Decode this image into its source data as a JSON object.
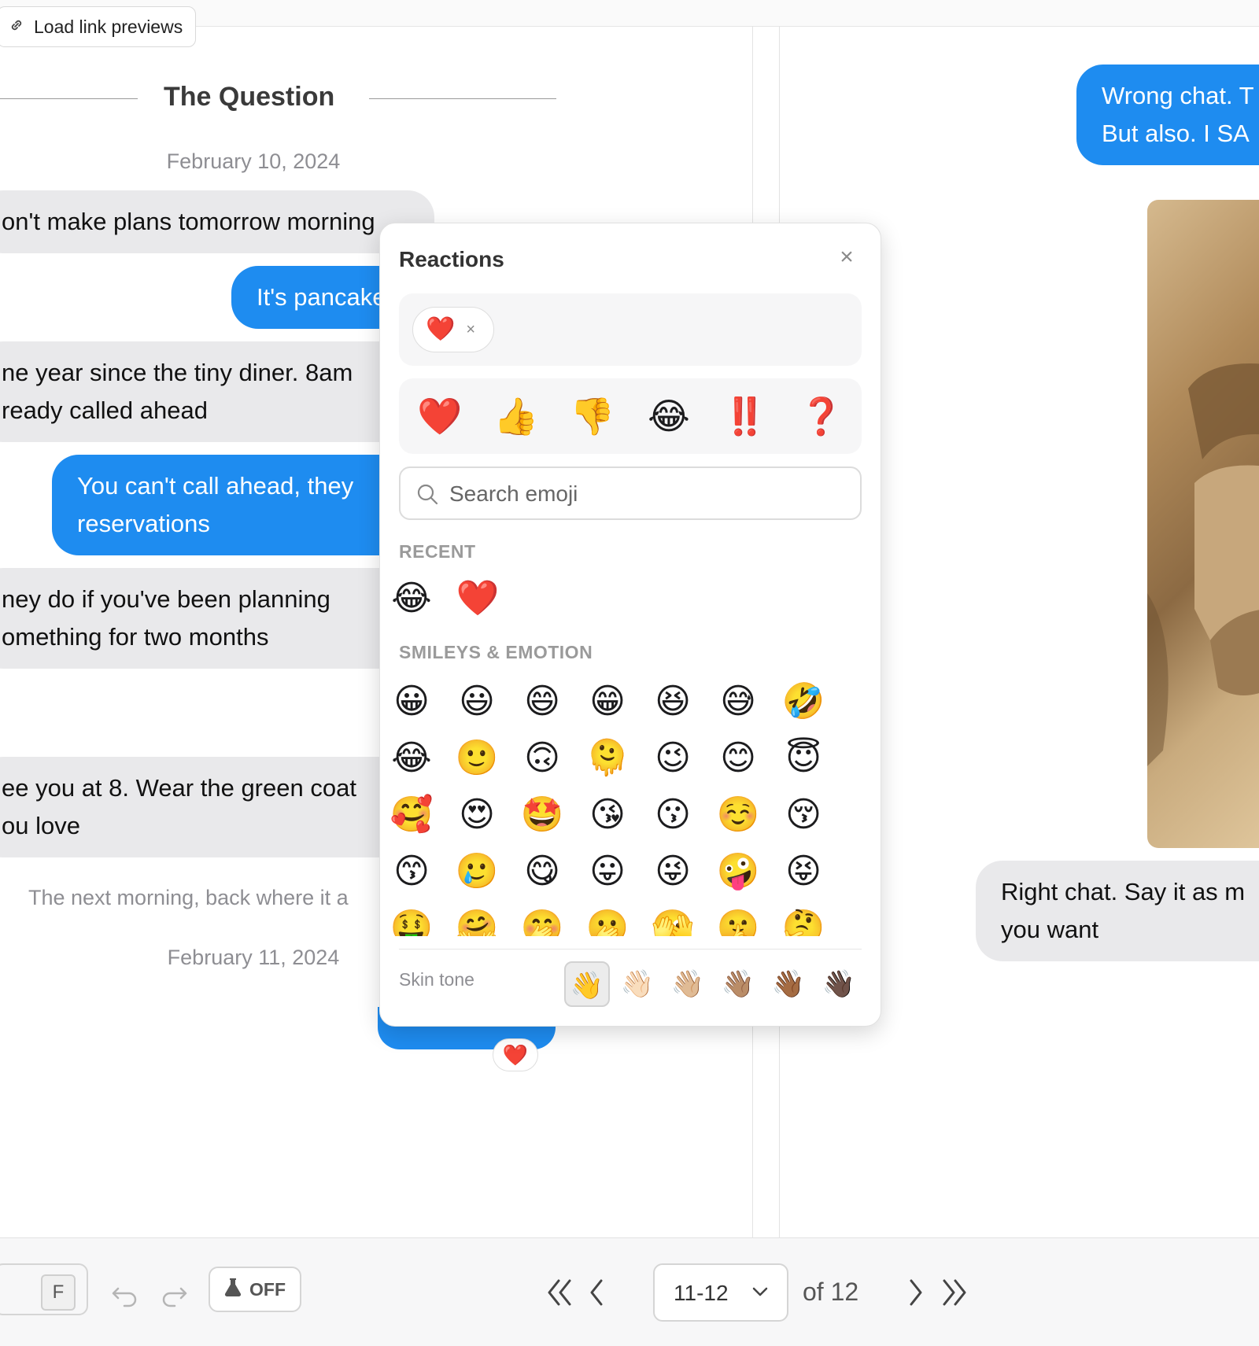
{
  "toolbar_top": {
    "link_previews_label": "Load link previews"
  },
  "chat_left": {
    "title": "The Question",
    "date1": "February 10, 2024",
    "messages": [
      {
        "type": "gray",
        "text": "on't make plans tomorrow morning"
      },
      {
        "type": "blue",
        "text": "It's pancake"
      },
      {
        "type": "gray",
        "line1": "ne year since the tiny diner. 8am",
        "line2": "ready called ahead"
      },
      {
        "type": "blue",
        "line1": "You can't call ahead, they",
        "line2": "reservations"
      },
      {
        "type": "gray",
        "line1": "ney do if you've been planning",
        "line2": "omething for two months"
      },
      {
        "type": "gray",
        "line1": "ee you at 8. Wear the green coat",
        "line2": "ou love"
      }
    ],
    "narration": "The next morning, back where it a",
    "date2": "February 11, 2024",
    "reaction_badge": "❤️"
  },
  "chat_right": {
    "messages": [
      {
        "type": "blue",
        "line1": "Wrong chat. T",
        "line2": "But also. I SA"
      },
      {
        "type": "gray",
        "line1": "Right chat. Say it as m",
        "line2": "you want"
      }
    ]
  },
  "reactions_popup": {
    "title": "Reactions",
    "close_icon": "×",
    "selected": {
      "emoji": "❤️",
      "remove_icon": "×"
    },
    "quick": [
      "❤️",
      "👍",
      "👎",
      "😂",
      "‼️",
      "❓"
    ],
    "search_placeholder": "Search emoji",
    "recent_label": "RECENT",
    "recent": [
      "😂",
      "❤️"
    ],
    "smileys_label": "SMILEYS & EMOTION",
    "smileys": [
      [
        "😀",
        "😃",
        "😄",
        "😁",
        "😆",
        "😅",
        "🤣"
      ],
      [
        "😂",
        "🙂",
        "🙃",
        "🫠",
        "😉",
        "😊",
        "😇"
      ],
      [
        "🥰",
        "😍",
        "🤩",
        "😘",
        "😗",
        "☺️",
        "😚"
      ],
      [
        "😙",
        "🥲",
        "😋",
        "😛",
        "😜",
        "🤪",
        "😝"
      ],
      [
        "🤑",
        "🤗",
        "🤭",
        "🫢",
        "🫣",
        "🤫",
        "🤔"
      ]
    ],
    "skin_label": "Skin tone",
    "skin_tones": [
      "👋",
      "👋🏻",
      "👋🏼",
      "👋🏽",
      "👋🏾",
      "👋🏿"
    ]
  },
  "toolbar_bottom": {
    "kbd_label": "F",
    "toggle_label": "OFF",
    "page_value": "11-12",
    "of_total": "of 12"
  }
}
